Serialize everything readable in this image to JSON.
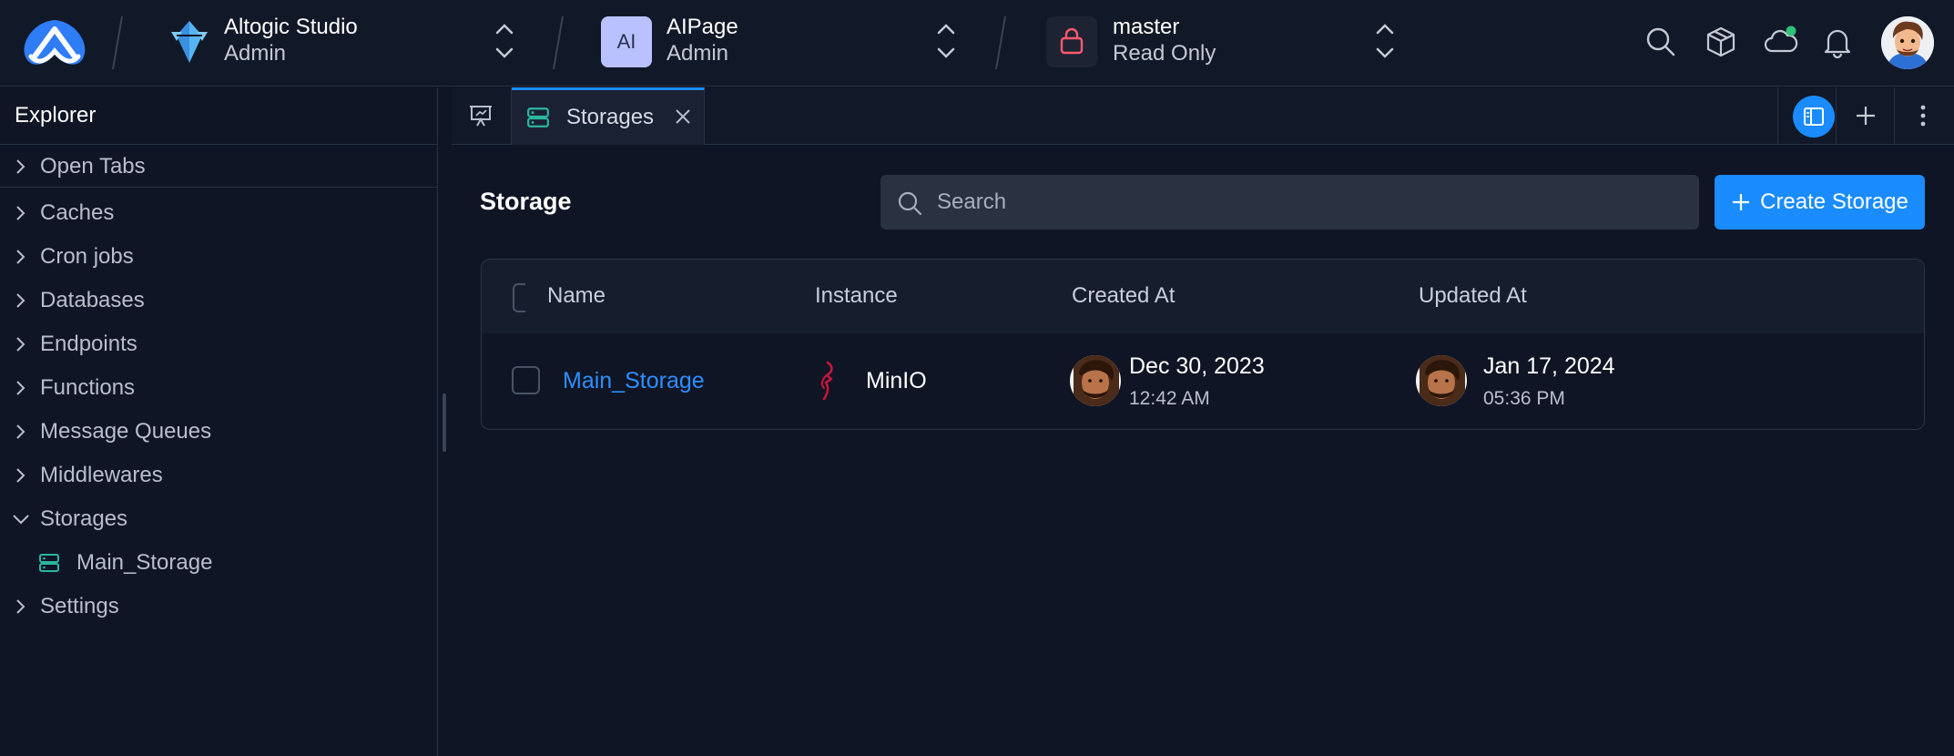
{
  "topbar": {
    "org": {
      "name": "Altogic Studio",
      "role": "Admin"
    },
    "app": {
      "initials": "AI",
      "name": "AIPage",
      "role": "Admin"
    },
    "env": {
      "name": "master",
      "access": "Read Only"
    },
    "icons": [
      "search-icon",
      "cube-icon",
      "cloud-icon",
      "bell-icon"
    ],
    "colors": {
      "cloud_status_dot": "#2fc27a",
      "app_badge": "#b9c2ff",
      "branch_lock": "#ff5a6e"
    }
  },
  "sidebar": {
    "title": "Explorer",
    "open_tabs": "Open Tabs",
    "items": [
      {
        "label": "Caches",
        "expanded": false
      },
      {
        "label": "Cron jobs",
        "expanded": false
      },
      {
        "label": "Databases",
        "expanded": false
      },
      {
        "label": "Endpoints",
        "expanded": false
      },
      {
        "label": "Functions",
        "expanded": false
      },
      {
        "label": "Message Queues",
        "expanded": false
      },
      {
        "label": "Middlewares",
        "expanded": false
      },
      {
        "label": "Storages",
        "expanded": true,
        "children": [
          {
            "label": "Main_Storage"
          }
        ]
      },
      {
        "label": "Settings",
        "expanded": false
      }
    ]
  },
  "tabs": {
    "active": {
      "label": "Storages",
      "icon": "storage-icon"
    }
  },
  "main": {
    "title": "Storage",
    "search": {
      "placeholder": "Search",
      "value": ""
    },
    "create_button": "Create Storage",
    "table": {
      "columns": [
        "Name",
        "Instance",
        "Created At",
        "Updated At"
      ],
      "rows": [
        {
          "name": "Main_Storage",
          "instance": "MinIO",
          "created_date": "Dec 30, 2023",
          "created_time": "12:42 AM",
          "updated_date": "Jan 17, 2024",
          "updated_time": "05:36 PM"
        }
      ]
    }
  },
  "colors": {
    "accent": "#1a8cff",
    "link": "#2d8fff",
    "background": "#0f1524"
  }
}
